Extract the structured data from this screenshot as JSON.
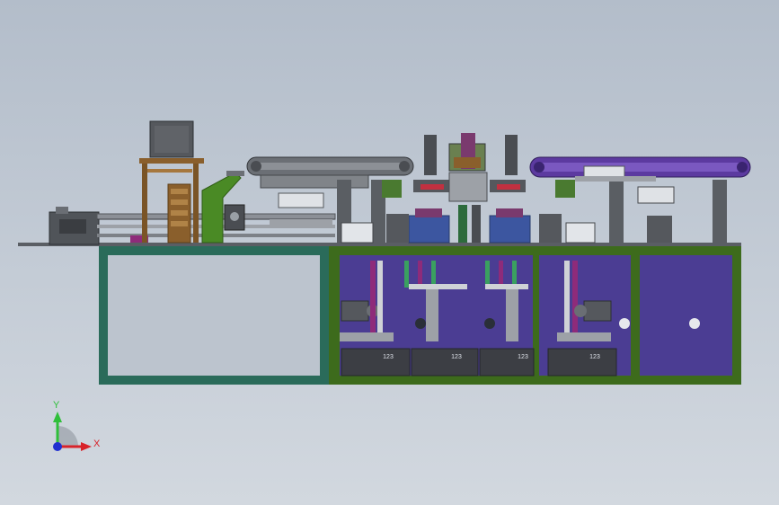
{
  "cabinet_labels": [
    "123",
    "123",
    "123",
    "123"
  ],
  "axes": {
    "y_label": "Y",
    "x_label": "X"
  },
  "colors": {
    "background": "#c2cad4",
    "frame_teal": "#2a6b5a",
    "frame_green": "#3d6b1c",
    "panel_purple": "#4b3d93",
    "conveyor_purple": "#5c3aa0",
    "machine_gray": "#4a4d52",
    "wood": "#8a5f2c",
    "chute_green": "#4a8a25",
    "axis_y": "#2fbf3a",
    "axis_x": "#d8232a",
    "axis_z": "#2030d0"
  }
}
